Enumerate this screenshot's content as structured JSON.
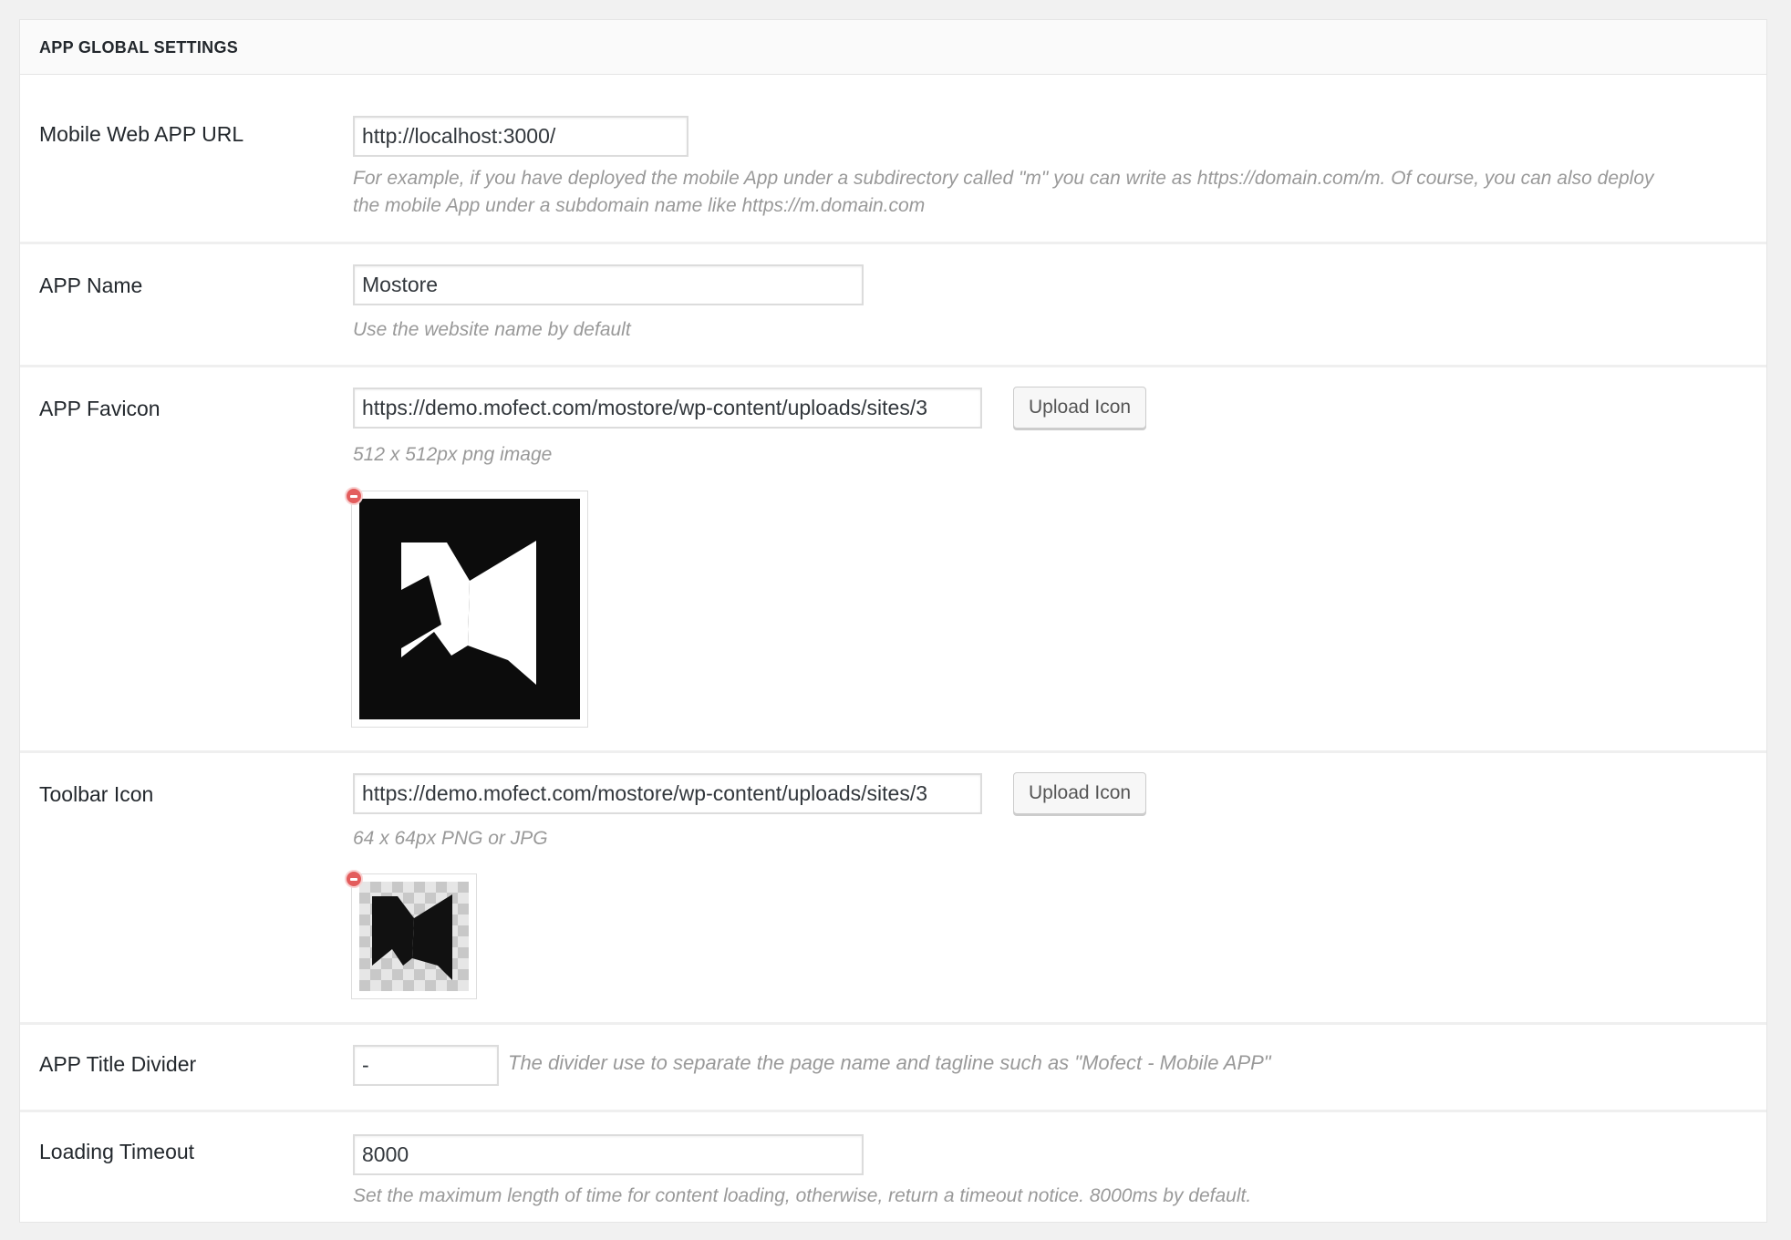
{
  "section": {
    "title": "APP GLOBAL SETTINGS"
  },
  "fields": {
    "mobile_url": {
      "label": "Mobile Web APP URL",
      "value": "http://localhost:3000/",
      "description_line1": "For example, if you have deployed the mobile App under a subdirectory called \"m\" you can write as https://domain.com/m. Of course, you can also deploy",
      "description_line2": "the mobile App under a subdomain name like https://m.domain.com"
    },
    "app_name": {
      "label": "APP Name",
      "value": "Mostore",
      "description": "Use the website name by default"
    },
    "favicon": {
      "label": "APP Favicon",
      "value": "https://demo.mofect.com/mostore/wp-content/uploads/sites/3",
      "button_label": "Upload Icon",
      "description": "512 x 512px png image",
      "preview_icon": "m-logo-icon"
    },
    "toolbar_icon": {
      "label": "Toolbar Icon",
      "value": "https://demo.mofect.com/mostore/wp-content/uploads/sites/3",
      "button_label": "Upload Icon",
      "description": "64 x 64px PNG or JPG",
      "preview_icon": "m-logo-icon"
    },
    "title_divider": {
      "label": "APP Title Divider",
      "value": "-",
      "description": "The divider use to separate the page name and tagline such as \"Mofect - Mobile APP\""
    },
    "loading_timeout": {
      "label": "Loading Timeout",
      "value": "8000",
      "description": "Set the maximum length of time for content loading, otherwise, return a timeout notice. 8000ms by default."
    }
  },
  "colors": {
    "remove_badge": "#e35d5d",
    "logo_background": "#0c0c0c"
  }
}
